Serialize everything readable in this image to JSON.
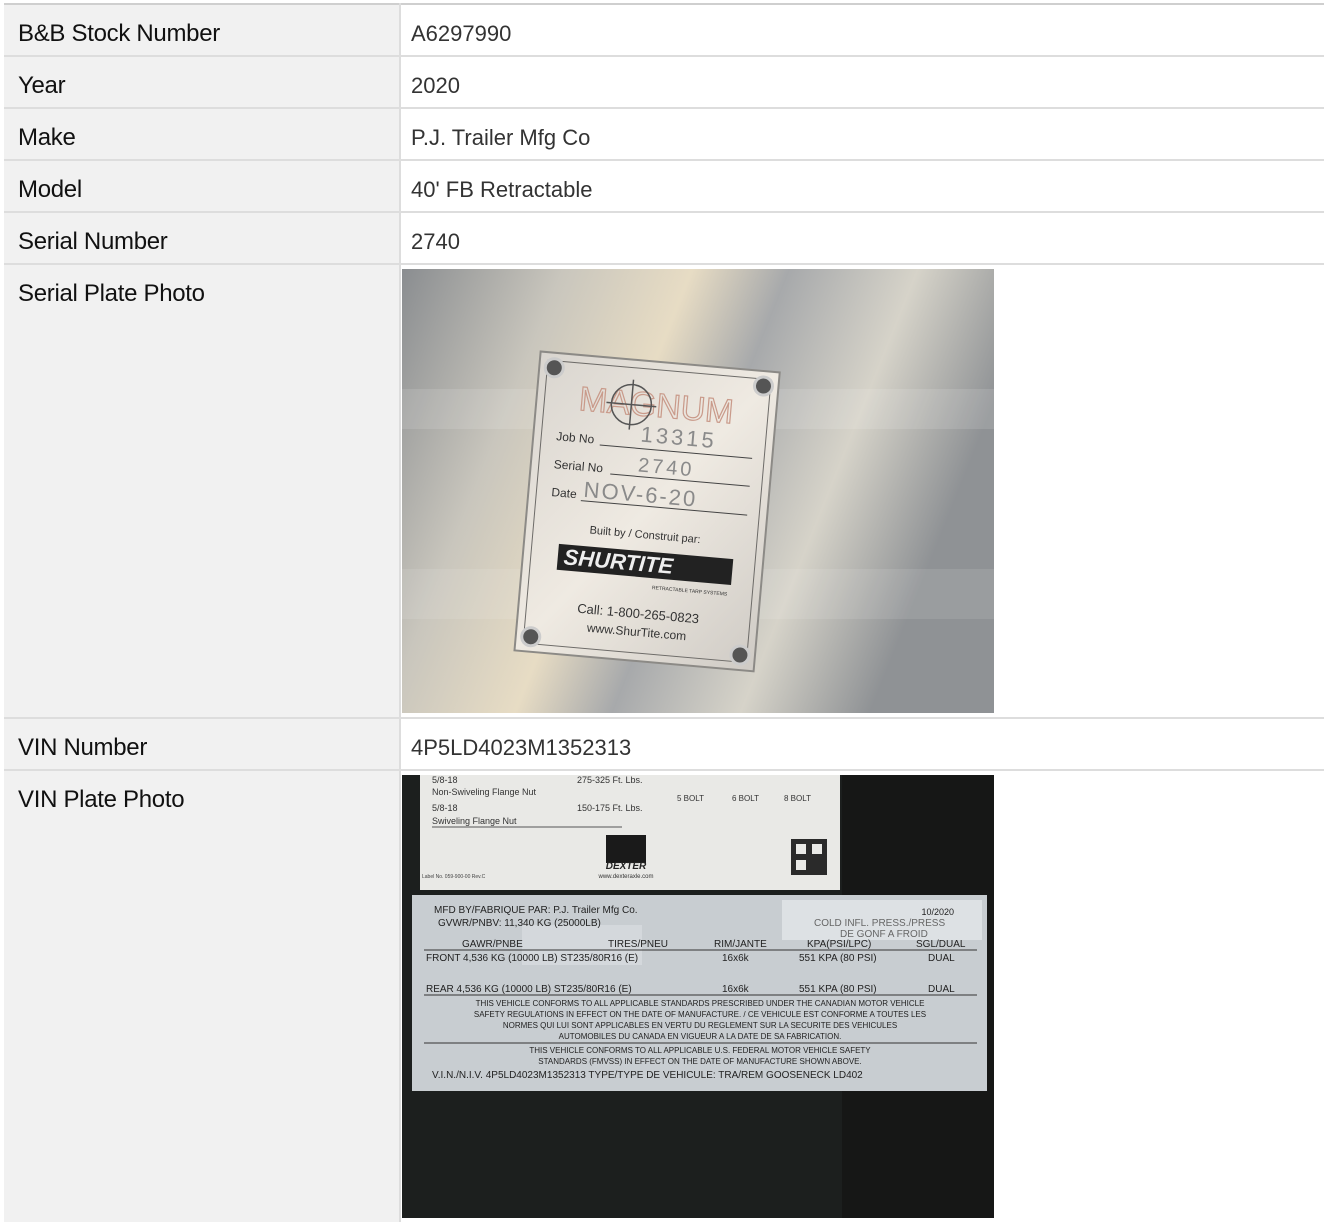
{
  "rows": [
    {
      "label": "B&B Stock Number",
      "value": "A6297990"
    },
    {
      "label": "Year",
      "value": "2020"
    },
    {
      "label": "Make",
      "value": "P.J. Trailer Mfg Co"
    },
    {
      "label": "Model",
      "value": "40' FB Retractable"
    },
    {
      "label": "Serial Number",
      "value": "2740"
    }
  ],
  "serial_photo": {
    "label": "Serial Plate Photo",
    "plate_brand": "MAGNUM",
    "job_label": "Job No",
    "job_value": "13315",
    "serial_label": "Serial No",
    "serial_value": "2740",
    "date_label": "Date",
    "date_value": "NOV-6-20",
    "built_by": "Built by / Construit par:",
    "logo": "SHURTITE",
    "logo_sub": "RETRACTABLE TARP SYSTEMS",
    "call": "Call: 1-800-265-0823",
    "web": "www.ShurTite.com"
  },
  "vin_row": {
    "label": "VIN Number",
    "value": "4P5LD4023M1352313"
  },
  "vin_photo": {
    "label": "VIN Plate Photo",
    "torque_1a": "5/8-18",
    "torque_1b": "Non-Swiveling Flange Nut",
    "torque_1v": "275-325 Ft. Lbs.",
    "torque_2a": "5/8-18",
    "torque_2b": "Swiveling Flange Nut",
    "torque_2v": "150-175 Ft. Lbs.",
    "bolt_5": "5 BOLT",
    "bolt_6": "6 BOLT",
    "bolt_8": "8 BOLT",
    "dexter": "DEXTER",
    "dexter_web": "www.dexteraxle.com",
    "label_no": "Label No. 059-900-00 Rev.C",
    "mfd": "MFD BY/FABRIQUE PAR: P.J. Trailer Mfg Co.",
    "mfd_date": "10/2020",
    "gvwr": "GVWR/PNBV: 11,340 KG (25000LB)",
    "cold": "COLD INFL. PRESS./PRESS",
    "cold2": "DE GONF A FROID",
    "h_gawr": "GAWR/PNBE",
    "h_tires": "TIRES/PNEU",
    "h_rim": "RIM/JANTE",
    "h_kpa": "KPA(PSI/LPC)",
    "h_sgl": "SGL/DUAL",
    "front": "FRONT  4,536 KG (10000 LB)  ST235/80R16 (E)",
    "front_rim": "16x6k",
    "front_kpa": "551 KPA (80 PSI)",
    "front_d": "DUAL",
    "rear": "REAR    4,536 KG (10000 LB)  ST235/80R16 (E)",
    "rear_rim": "16x6k",
    "rear_kpa": "551 KPA (80 PSI)",
    "rear_d": "DUAL",
    "can1": "THIS VEHICLE CONFORMS TO ALL APPLICABLE STANDARDS PRESCRIBED UNDER THE CANADIAN MOTOR VEHICLE",
    "can2": "SAFETY REGULATIONS IN EFFECT ON THE DATE OF MANUFACTURE. / CE VEHICULE EST CONFORME A TOUTES LES",
    "can3": "NORMES QUI LUI SONT APPLICABLES EN VERTU DU REGLEMENT SUR LA SECURITE DES VEHICULES",
    "can4": "AUTOMOBILES DU CANADA EN VIGUEUR A LA DATE DE SA FABRICATION.",
    "us1": "THIS VEHICLE CONFORMS TO ALL APPLICABLE U.S. FEDERAL MOTOR VEHICLE SAFETY",
    "us2": "STANDARDS (FMVSS) IN EFFECT ON THE DATE OF MANUFACTURE SHOWN ABOVE.",
    "vin_line": "V.I.N./N.I.V. 4P5LD4023M1352313   TYPE/TYPE DE VEHICULE:  TRA/REM GOOSENECK LD402"
  }
}
